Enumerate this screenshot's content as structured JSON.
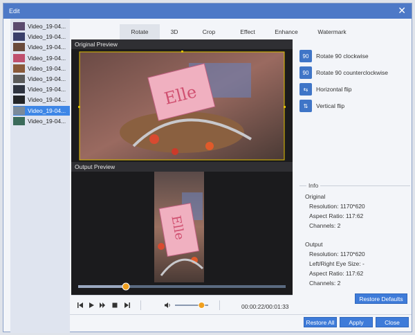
{
  "window": {
    "title": "Edit",
    "close_glyph": "✕"
  },
  "files": [
    {
      "name": "Video_19-04...",
      "thumb_color": "#5b4a6e"
    },
    {
      "name": "Video_19-04...",
      "thumb_color": "#3a3f6a"
    },
    {
      "name": "Video_19-04...",
      "thumb_color": "#6a4a3a"
    },
    {
      "name": "Video_19-04...",
      "thumb_color": "#c0506e"
    },
    {
      "name": "Video_19-04...",
      "thumb_color": "#8a5a3a"
    },
    {
      "name": "Video_19-04...",
      "thumb_color": "#5a5a5a"
    },
    {
      "name": "Video_19-04...",
      "thumb_color": "#2e3340"
    },
    {
      "name": "Video_19-04...",
      "thumb_color": "#222428"
    },
    {
      "name": "Video_19-04...",
      "thumb_color": "#7a8a9a",
      "selected": true
    },
    {
      "name": "Video_19-04...",
      "thumb_color": "#3b6b5a"
    }
  ],
  "tabs": [
    "Rotate",
    "3D",
    "Crop",
    "Effect",
    "Enhance",
    "Watermark"
  ],
  "active_tab": "Rotate",
  "original_preview_label": "Original Preview",
  "output_preview_label": "Output Preview",
  "overlay_text": "Elle",
  "rotate_options": [
    {
      "label": "Rotate 90 clockwise",
      "icon": "rotate-clockwise-icon",
      "glyph": "90"
    },
    {
      "label": "Rotate 90 counterclockwise",
      "icon": "rotate-counterclockwise-icon",
      "glyph": "90"
    },
    {
      "label": "Horizontal flip",
      "icon": "horizontal-flip-icon",
      "glyph": "⇆"
    },
    {
      "label": "Vertical flip",
      "icon": "vertical-flip-icon",
      "glyph": "⇅"
    }
  ],
  "info": {
    "legend": "Info",
    "original_heading": "Original",
    "original_resolution": "Resolution: 1170*620",
    "original_aspect": "Aspect Ratio: 117:62",
    "original_channels": "Channels: 2",
    "output_heading": "Output",
    "output_resolution": "Resolution: 1170*620",
    "output_eye_size": "Left/Right Eye Size: -",
    "output_aspect": "Aspect Ratio: 117:62",
    "output_channels": "Channels: 2"
  },
  "player": {
    "time": "00:00:22/00:01:33",
    "progress": 0.23,
    "volume": 0.8
  },
  "buttons": {
    "restore_defaults": "Restore Defaults",
    "restore_all": "Restore All",
    "apply": "Apply",
    "close": "Close"
  },
  "colors": {
    "accent": "#3e7bd9",
    "titlebar": "#4d79c7",
    "progress_handle": "#f0a020"
  }
}
